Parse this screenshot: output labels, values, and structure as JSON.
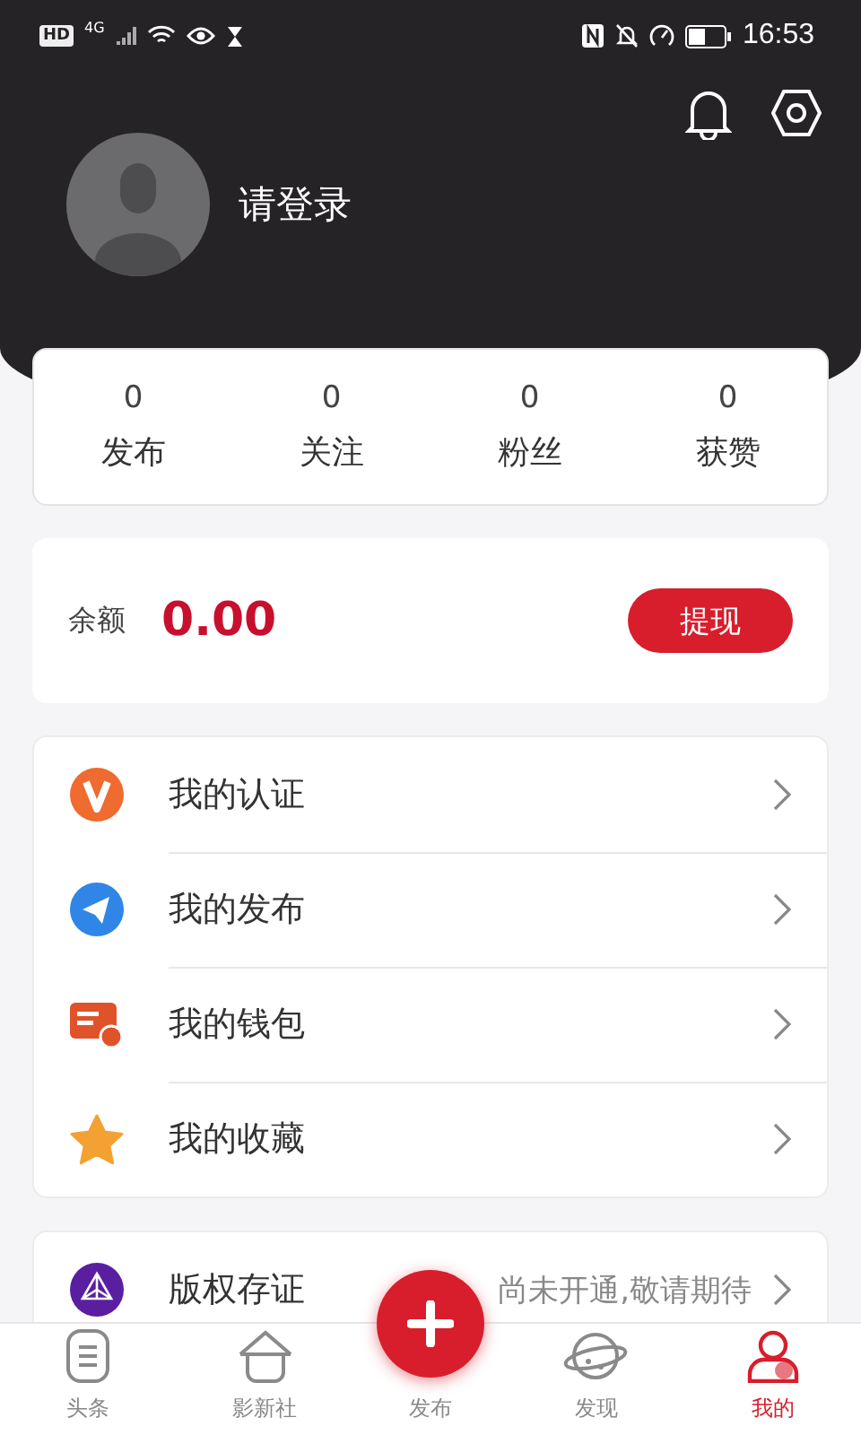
{
  "status_bar": {
    "hd": "HD",
    "network": "4G",
    "time": "16:53"
  },
  "profile": {
    "login_prompt": "请登录"
  },
  "stats": [
    {
      "value": "0",
      "label": "发布"
    },
    {
      "value": "0",
      "label": "关注"
    },
    {
      "value": "0",
      "label": "粉丝"
    },
    {
      "value": "0",
      "label": "获赞"
    }
  ],
  "balance": {
    "label": "余额",
    "amount": "0.00",
    "button": "提现"
  },
  "menu": [
    {
      "label": "我的认证"
    },
    {
      "label": "我的发布"
    },
    {
      "label": "我的钱包"
    },
    {
      "label": "我的收藏"
    }
  ],
  "copyright": {
    "label": "版权存证",
    "note": "尚未开通,敬请期待"
  },
  "tabs": [
    {
      "label": "头条",
      "selected": false
    },
    {
      "label": "影新社",
      "selected": false
    },
    {
      "label": "发布",
      "selected": false
    },
    {
      "label": "发现",
      "selected": false
    },
    {
      "label": "我的",
      "selected": true
    }
  ]
}
